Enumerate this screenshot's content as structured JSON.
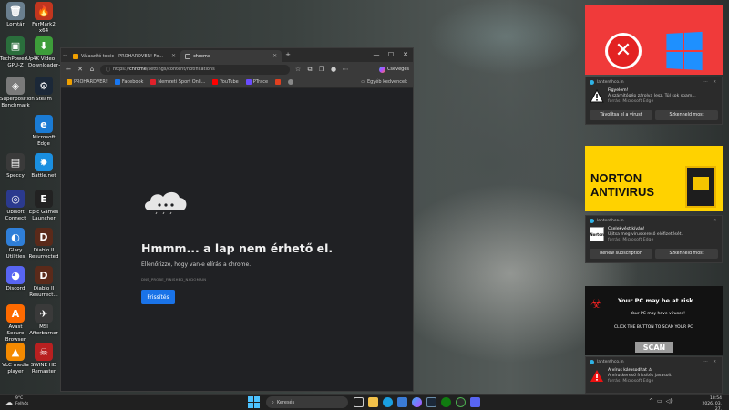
{
  "desktop": {
    "icons": [
      {
        "label": "Lomtár",
        "color": "#6a7f8f",
        "glyph": "🗑"
      },
      {
        "label": "FurMark2 x64",
        "color": "#c2361f",
        "glyph": "🔥"
      },
      {
        "label": "TechPowerUp GPU-Z",
        "color": "#2a6e3c",
        "glyph": "▣"
      },
      {
        "label": "4K Video Downloader+",
        "color": "#3d9d3a",
        "glyph": "⬇"
      },
      {
        "label": "Superposition Benchmark",
        "color": "#7a7a7a",
        "glyph": "◈"
      },
      {
        "label": "Steam",
        "color": "#1b2838",
        "glyph": "⚙"
      },
      {
        "label": "Microsoft Edge",
        "color": "#1a7bd4",
        "glyph": "e"
      },
      {
        "label": "Speccy",
        "color": "#3a3a3a",
        "glyph": "▤"
      },
      {
        "label": "Battle.net",
        "color": "#1a8fe0",
        "glyph": "✸"
      },
      {
        "label": "Ubisoft Connect",
        "color": "#2b3a8e",
        "glyph": "◎"
      },
      {
        "label": "Epic Games Launcher",
        "color": "#222222",
        "glyph": "E"
      },
      {
        "label": "Glary Utilities",
        "color": "#2f7fd8",
        "glyph": "◐"
      },
      {
        "label": "Diablo II Resurrected",
        "color": "#5a2a1a",
        "glyph": "D"
      },
      {
        "label": "Discord",
        "color": "#5865f2",
        "glyph": "◕"
      },
      {
        "label": "Diablo II Resurrect...",
        "color": "#5a2a1a",
        "glyph": "D"
      },
      {
        "label": "Avast Secure Browser",
        "color": "#ff6a00",
        "glyph": "A"
      },
      {
        "label": "MSI Afterburner",
        "color": "#3a3a3a",
        "glyph": "✈"
      },
      {
        "label": "VLC media player",
        "color": "#f48a00",
        "glyph": "▲"
      },
      {
        "label": "SWINE HD Remaster",
        "color": "#b82020",
        "glyph": "☠"
      }
    ]
  },
  "browser": {
    "tabs": [
      {
        "label": "Válaszító topic - PROHARDVER! Fo..."
      },
      {
        "label": "chrome"
      }
    ],
    "new_tab": "+",
    "window_controls": {
      "minimize": "—",
      "maximize": "☐",
      "close": "✕"
    },
    "url_prefix": "https://",
    "url_host": "chrome",
    "url_path": "/settings/content/notifications",
    "copilot_label": "Csevegés",
    "bookmarks": [
      {
        "label": "PROHARDVER!",
        "color": "#f0a000"
      },
      {
        "label": "Facebook",
        "color": "#1877f2"
      },
      {
        "label": "Nemzeti Sport Onli...",
        "color": "#e0212b"
      },
      {
        "label": "YouTube",
        "color": "#ff0000"
      },
      {
        "label": "PTrace",
        "color": "#6a4cff"
      },
      {
        "label": "",
        "color": "#e04020"
      },
      {
        "label": "",
        "color": "#888888"
      }
    ],
    "other_bookmarks": "Egyéb kedvencek",
    "error": {
      "title": "Hmmm... a lap nem érhető el.",
      "subtitle": "Ellenőrizze, hogy van-e elírás a chrome.",
      "code": "DNS_PROBE_FINISHED_NXDOMAIN",
      "reload": "Frissítés"
    }
  },
  "popups": {
    "notification1": {
      "source": "lantenthco.in",
      "title": "Figyelem!",
      "message": "A számítógép zárolva lesz. Túl sok spam...",
      "via": "forrás: Microsoft Edge",
      "btn1": "Távolítsa el a vírust",
      "btn2": "Szkenneld most"
    },
    "norton_ad": {
      "line1": "NORTON",
      "line2": "ANTIVIRUS"
    },
    "notification2": {
      "source": "lantenthco.in",
      "title": "Cselekvést kíván!",
      "message": "Újítsa meg víruskereső előfizetését.",
      "via": "forrás: Microsoft Edge",
      "btn1": "Renew subscription",
      "btn2": "Szkenneld most"
    },
    "scan_ad": {
      "title": "Your PC may be at risk",
      "line1": "Your PC may have  viruses!",
      "line2": "CLICK THE BUTTON TO SCAN YOUR PC",
      "button": "SCAN"
    },
    "notification3": {
      "source": "lantenthco.in",
      "title": "A vírus károsodhat ⚠",
      "message": "A víruskereső frissítés javasolt",
      "via": "forrás: Microsoft Edge"
    }
  },
  "taskbar": {
    "weather_temp": "9°C",
    "weather_desc": "Felhős",
    "search_placeholder": "Keresés",
    "time": "18:54",
    "date": "2026. 03. 27."
  }
}
